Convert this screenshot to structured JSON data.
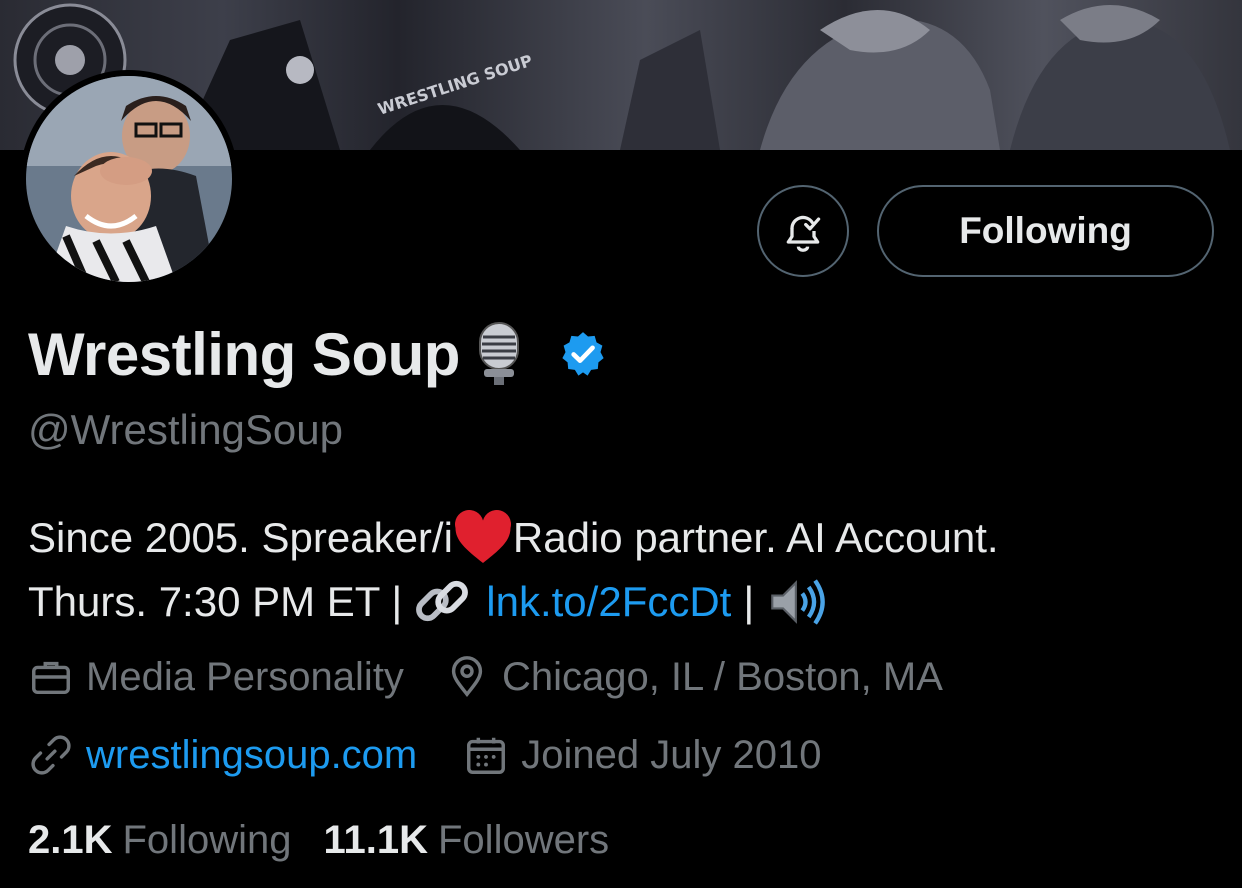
{
  "profile": {
    "display_name": "Wrestling Soup",
    "name_emoji": "studio-microphone",
    "verified": true,
    "handle": "@WrestlingSoup",
    "bio_line1_before": "Since 2005. Spreaker/i",
    "bio_heart": "heart-emoji",
    "bio_line1_after": "Radio partner. AI Account.",
    "bio_line2_before": "Thurs. 7:30 PM ET |",
    "bio_link_icon": "link-emoji",
    "bio_link": "lnk.to/2FccDt",
    "bio_line2_after": "|",
    "bio_speaker": "speaker-emoji",
    "category": "Media Personality",
    "location": "Chicago, IL / Boston, MA",
    "website": "wrestlingsoup.com",
    "joined": "Joined July 2010"
  },
  "actions": {
    "following_label": "Following",
    "notify_icon": "bell-check-icon"
  },
  "stats": {
    "following_count": "2.1K",
    "following_label": "Following",
    "followers_count": "11.1K",
    "followers_label": "Followers"
  },
  "colors": {
    "background": "#000000",
    "text": "#e7e9ea",
    "muted": "#71767b",
    "accent": "#1d9bf0",
    "border": "#536471"
  }
}
